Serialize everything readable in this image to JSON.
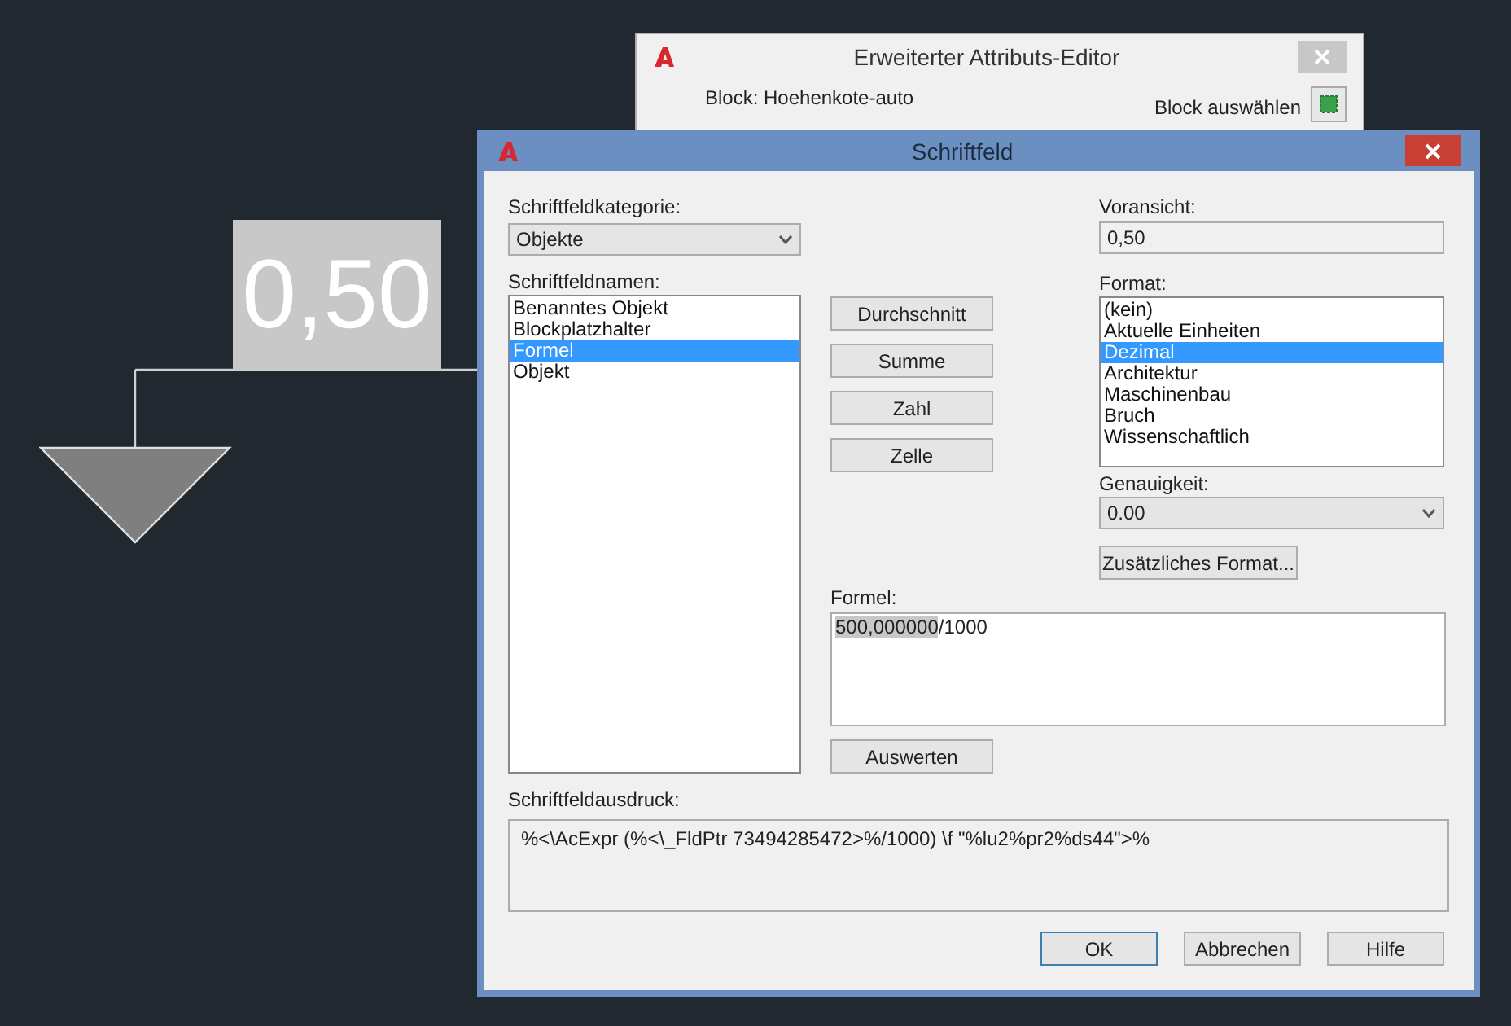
{
  "canvas": {
    "label": "0,50"
  },
  "back_window": {
    "title": "Erweiterter Attributs-Editor",
    "block_label": "Block: Hoehenkote-auto",
    "select_label": "Block auswählen"
  },
  "dialog": {
    "title": "Schriftfeld",
    "category_label": "Schriftfeldkategorie:",
    "category_value": "Objekte",
    "names_label": "Schriftfeldnamen:",
    "names": [
      {
        "label": "Benanntes Objekt",
        "selected": false
      },
      {
        "label": "Blockplatzhalter",
        "selected": false
      },
      {
        "label": "Formel",
        "selected": true
      },
      {
        "label": "Objekt",
        "selected": false
      }
    ],
    "function_buttons": [
      "Durchschnitt",
      "Summe",
      "Zahl",
      "Zelle"
    ],
    "preview_label": "Voransicht:",
    "preview_value": "0,50",
    "format_label": "Format:",
    "formats": [
      {
        "label": "(kein)",
        "selected": false
      },
      {
        "label": "Aktuelle Einheiten",
        "selected": false
      },
      {
        "label": "Dezimal",
        "selected": true
      },
      {
        "label": "Architektur",
        "selected": false
      },
      {
        "label": "Maschinenbau",
        "selected": false
      },
      {
        "label": "Bruch",
        "selected": false
      },
      {
        "label": "Wissenschaftlich",
        "selected": false
      }
    ],
    "precision_label": "Genauigkeit:",
    "precision_value": "0.00",
    "extra_format_button": "Zusätzliches Format...",
    "formula_label": "Formel:",
    "formula_highlight": "500,000000",
    "formula_rest": "/1000",
    "evaluate_button": "Auswerten",
    "expression_label": "Schriftfeldausdruck:",
    "expression": "%<\\AcExpr (%<\\_FldPtr 73494285472>%/1000) \\f \"%lu2%pr2%ds44\">%",
    "buttons": [
      {
        "label": "OK",
        "selected": true
      },
      {
        "label": "Abbrechen",
        "selected": false
      },
      {
        "label": "Hilfe",
        "selected": false
      }
    ]
  }
}
